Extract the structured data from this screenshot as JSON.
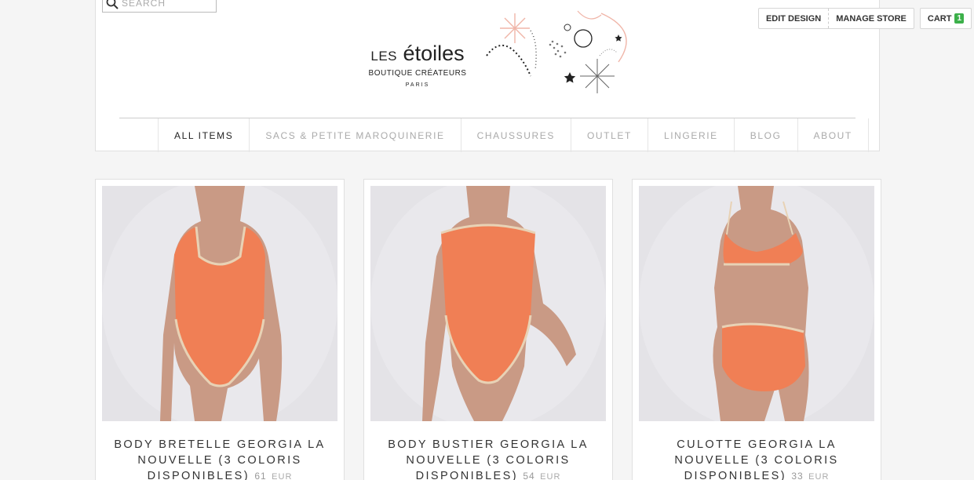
{
  "admin": {
    "edit_design": "EDIT DESIGN",
    "manage_store": "MANAGE STORE",
    "cart_label": "CART",
    "cart_count": "1"
  },
  "search": {
    "placeholder": "SEARCH"
  },
  "logo": {
    "les": "LES",
    "etoiles": "étoiles",
    "subtitle": "BOUTIQUE CRÉATEURS",
    "city": "PARIS"
  },
  "nav": {
    "items": [
      {
        "label": "ALL ITEMS",
        "active": true
      },
      {
        "label": "SACS & PETITE MAROQUINERIE"
      },
      {
        "label": "CHAUSSURES"
      },
      {
        "label": "OUTLET"
      },
      {
        "label": "LINGERIE"
      },
      {
        "label": "BLOG"
      },
      {
        "label": "ABOUT"
      }
    ]
  },
  "products": [
    {
      "name": "BODY BRETELLE GEORGIA LA NOUVELLE (3 COLORIS DISPONIBLES)",
      "price": "61",
      "currency": "EUR"
    },
    {
      "name": "BODY BUSTIER GEORGIA LA NOUVELLE (3 COLORIS DISPONIBLES)",
      "price": "54",
      "currency": "EUR"
    },
    {
      "name": "CULOTTE GEORGIA LA NOUVELLE (3 COLORIS DISPONIBLES)",
      "price": "33",
      "currency": "EUR"
    }
  ],
  "colors": {
    "background": "#f5f5f5",
    "cart_badge": "#3cb04a",
    "garment": "#f07f55",
    "skin": "#c99a85"
  }
}
